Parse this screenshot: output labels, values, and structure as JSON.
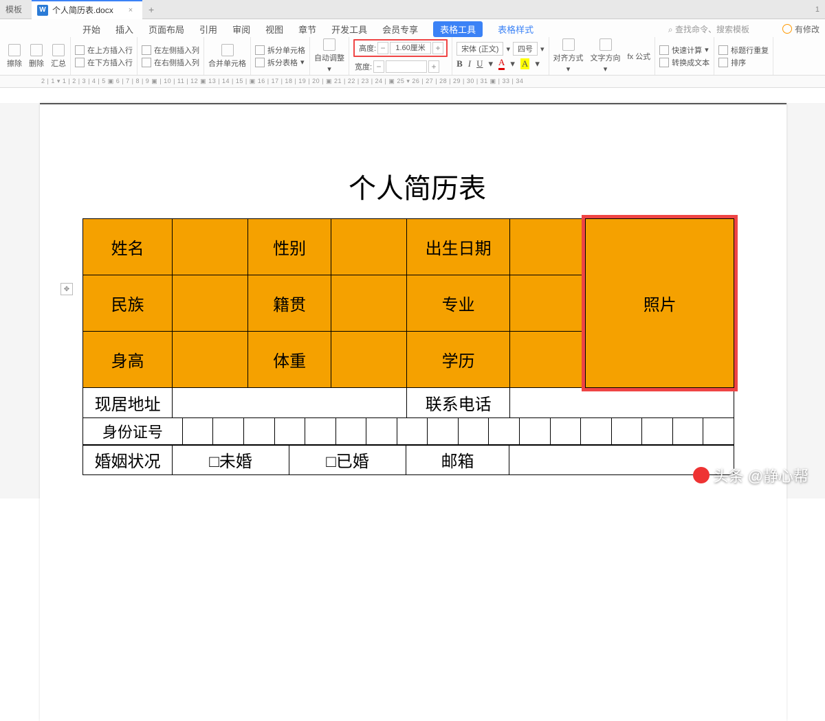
{
  "titlebar": {
    "template_tab": "模板",
    "doc_icon": "W",
    "doc_name": "个人简历表.docx",
    "close": "×",
    "plus": "+",
    "window_mode": "1"
  },
  "qat": {
    "undo": "↶",
    "redo": "↷",
    "sep": "▾"
  },
  "tabs": {
    "items": [
      "开始",
      "插入",
      "页面布局",
      "引用",
      "审阅",
      "视图",
      "章节",
      "开发工具",
      "会员专享"
    ],
    "table_tools": "表格工具",
    "table_style": "表格样式",
    "search_placeholder": "查找命令、搜索模板",
    "search_icon": "⌕",
    "modified": "有修改"
  },
  "ribbon": {
    "erase": "擦除",
    "delete": "删除",
    "summary": "汇总",
    "insert_above": "在上方插入行",
    "insert_below": "在下方插入行",
    "insert_left": "在左侧插入列",
    "insert_right": "在右侧插入列",
    "merge": "合并单元格",
    "split_cell": "拆分单元格",
    "split_table": "拆分表格",
    "autofit": "自动调整",
    "height_label": "高度:",
    "height_value": "1.60厘米",
    "height_minus": "−",
    "height_plus": "+",
    "width_label": "宽度:",
    "width_minus": "−",
    "width_plus": "+",
    "font_name": "宋体 (正文)",
    "font_size": "四号",
    "bold": "B",
    "italic": "I",
    "underline": "U",
    "font_color": "A",
    "highlight": "A",
    "align": "对齐方式",
    "text_dir": "文字方向",
    "formula": "fx 公式",
    "quick_calc": "快速计算",
    "header_repeat": "标题行重复",
    "to_text": "转换成文本",
    "sort": "排序"
  },
  "ruler": {
    "marks": "2   |   1    ▾   1  |  2  |  3  |  4  |  5 ▣ 6  |  7  |  8  |  9 ▣  |  10  |  11  |  12 ▣ 13  |  14  |  15  | ▣ 16  |  17  |  18  |  19  |  20  | ▣ 21  |  22  |  23  |  24  | ▣ 25 ▾ 26  |  27  |  28  |  29  |  30  |  31 ▣  |  33  |  34"
  },
  "doc": {
    "title": "个人简历表",
    "row1": {
      "c1": "姓名",
      "c2": "性别",
      "c3": "出生日期"
    },
    "row2": {
      "c1": "民族",
      "c2": "籍贯",
      "c3": "专业"
    },
    "row3": {
      "c1": "身高",
      "c2": "体重",
      "c3": "学历"
    },
    "photo": "照片",
    "row4": {
      "c1": "现居地址",
      "c2": "联系电话"
    },
    "row5": {
      "c1": "身份证号"
    },
    "row6": {
      "c1": "婚姻状况",
      "c2": "□未婚",
      "c3": "□已婚",
      "c4": "邮箱"
    }
  },
  "watermark": {
    "brand": "头条",
    "author": "@静心帮"
  }
}
